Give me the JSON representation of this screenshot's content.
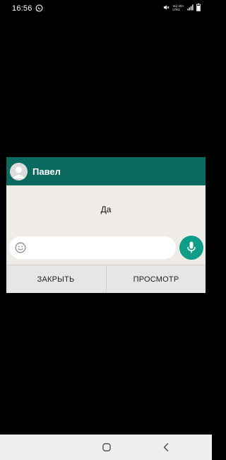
{
  "status_bar": {
    "time": "16:56",
    "network_top": "Vo) 4G+",
    "network_bottom": "LTE1",
    "icons": [
      "whatsapp-icon",
      "mute-icon",
      "signal-icon",
      "battery-icon"
    ]
  },
  "popup": {
    "contact_name": "Павел",
    "message": "Да",
    "input": {
      "value": "",
      "placeholder": ""
    },
    "actions": {
      "close_label": "ЗАКРЫТЬ",
      "view_label": "ПРОСМОТР"
    }
  },
  "colors": {
    "header": "#0b6a5f",
    "mic": "#0e9d86",
    "body": "#efebe6"
  },
  "nav_bar": {
    "icons": [
      "home-icon",
      "back-icon"
    ]
  }
}
